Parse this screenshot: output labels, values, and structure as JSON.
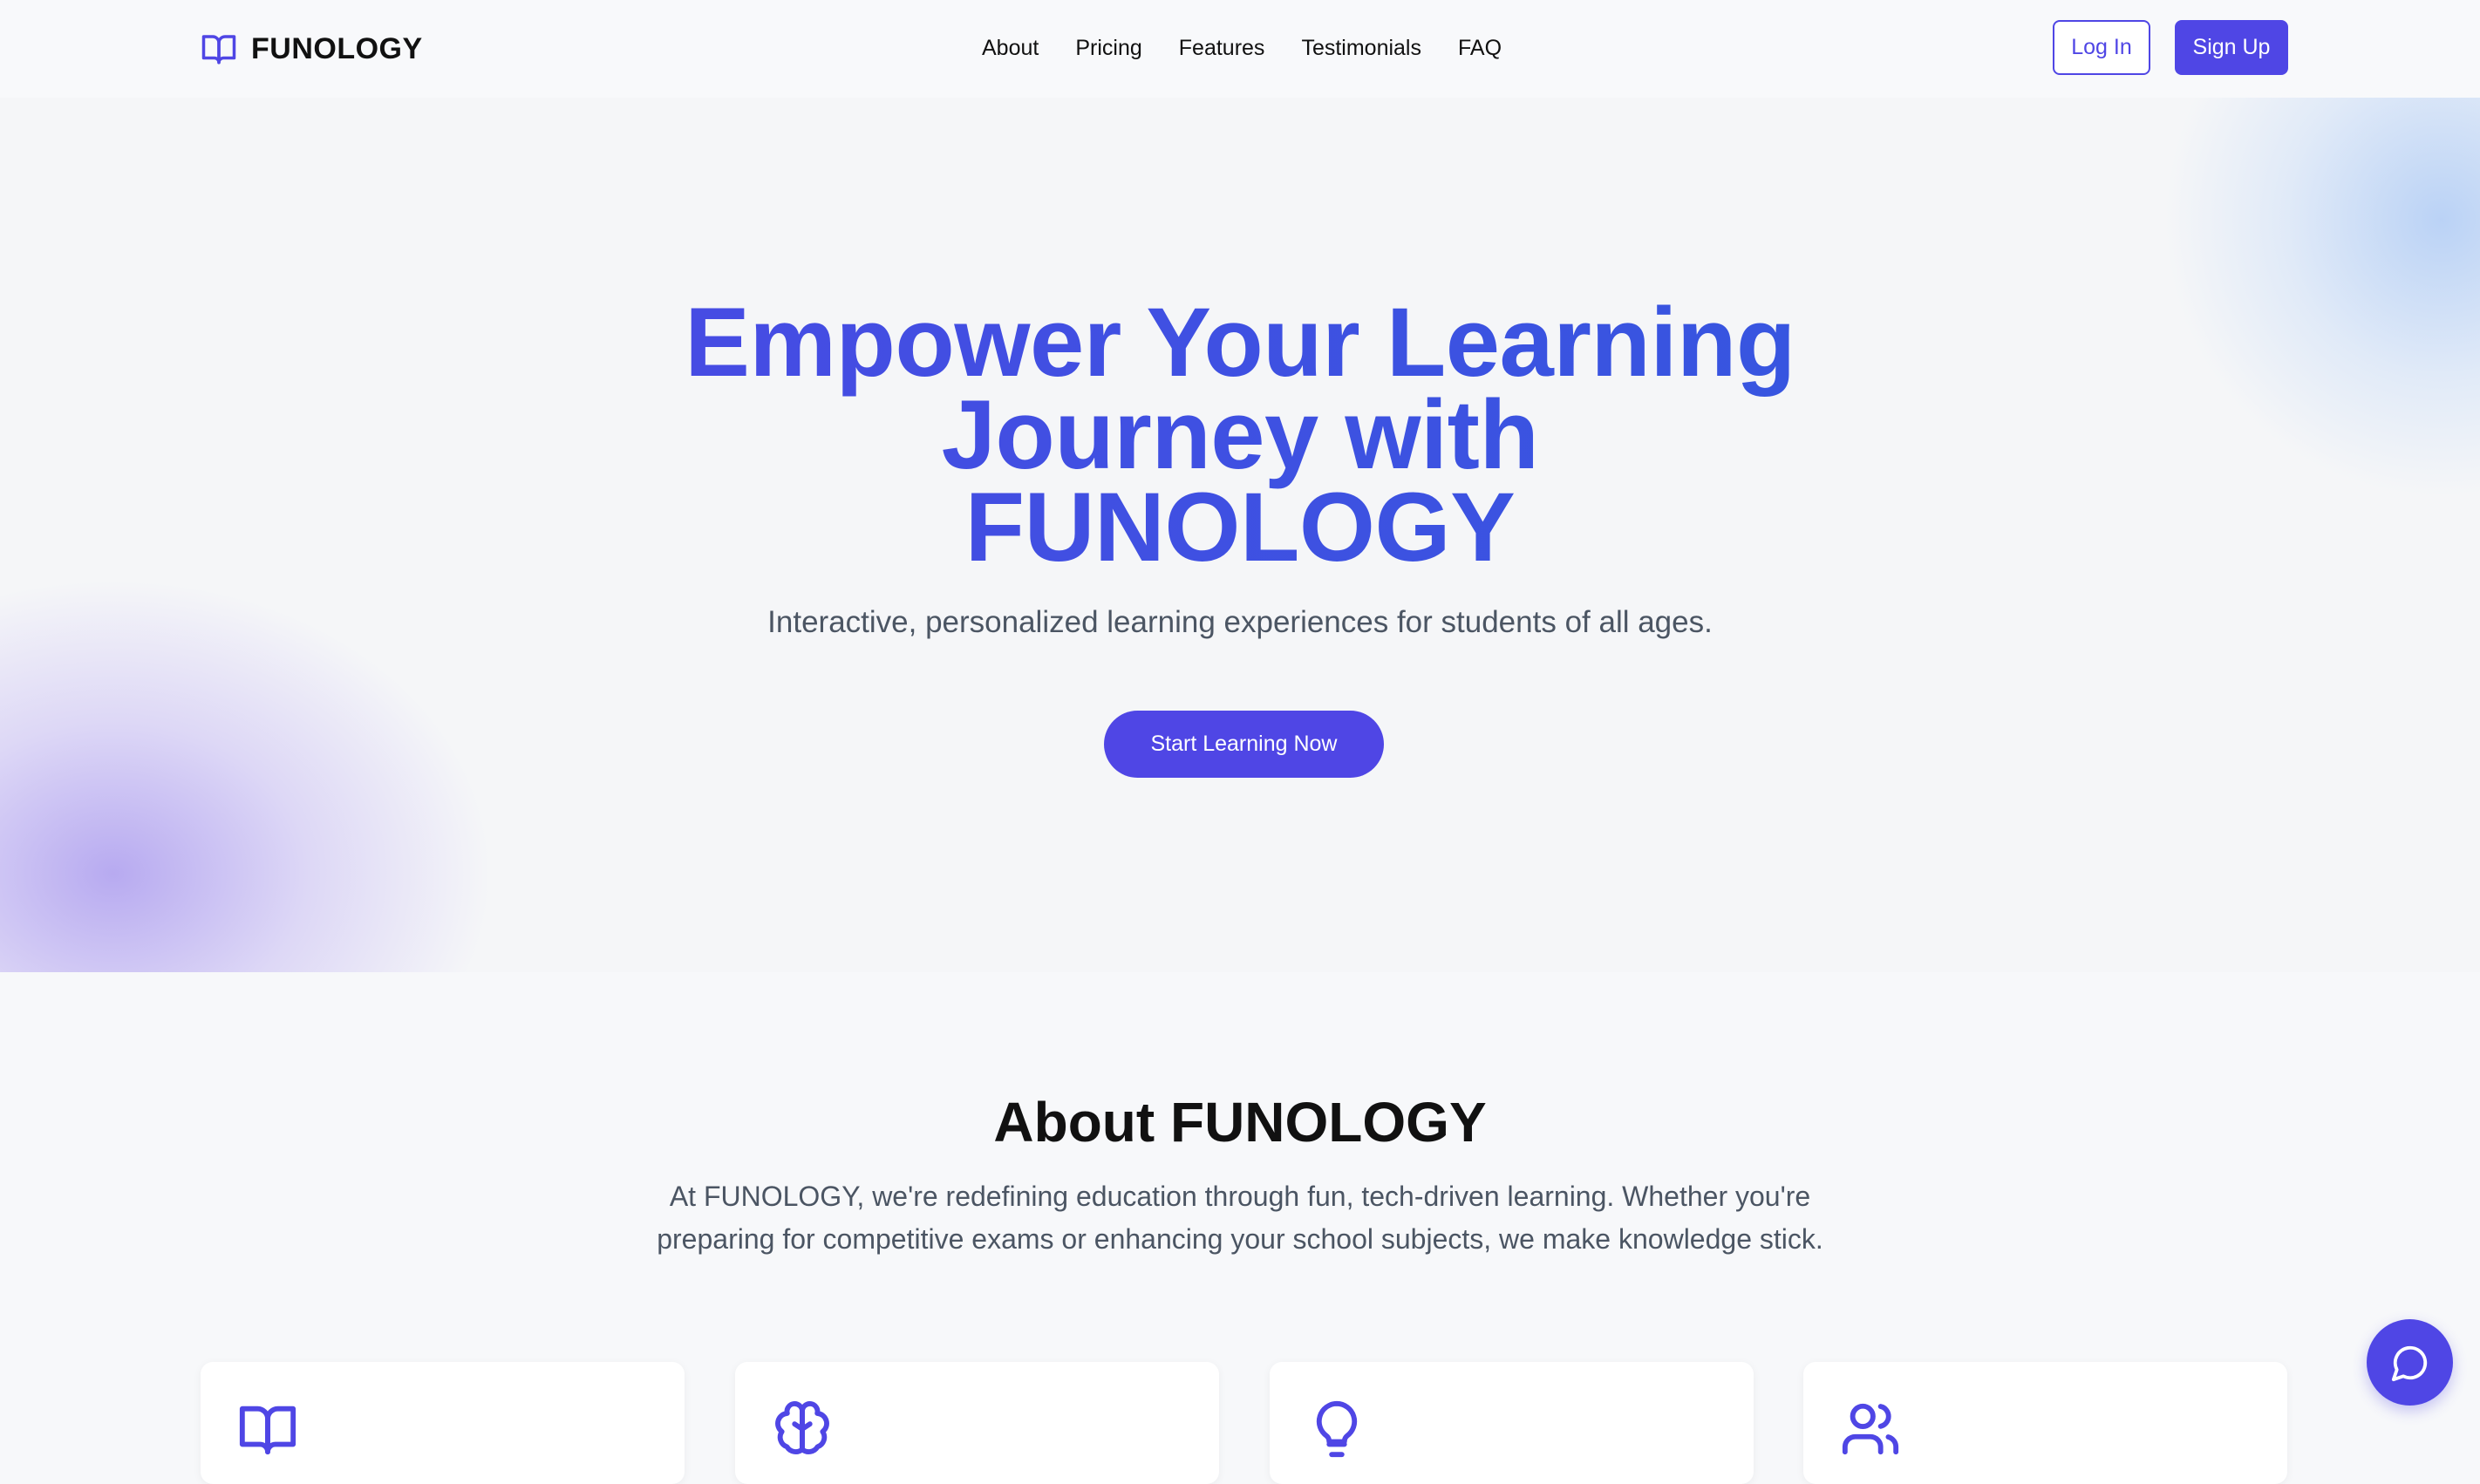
{
  "brand": {
    "name": "FUNOLOGY",
    "icon": "open-book-icon"
  },
  "nav": {
    "links": [
      "About",
      "Pricing",
      "Features",
      "Testimonials",
      "FAQ"
    ],
    "login_label": "Log In",
    "signup_label": "Sign Up"
  },
  "hero": {
    "title_line1": "Empower Your Learning",
    "title_line2": "Journey with",
    "title_line3": "FUNOLOGY",
    "subtitle": "Interactive, personalized learning experiences for students of all ages.",
    "cta_label": "Start Learning Now"
  },
  "about": {
    "title": "About FUNOLOGY",
    "text_line1": "At FUNOLOGY, we're redefining education through fun, tech-driven learning. Whether you're",
    "text_line2": "preparing for competitive exams or enhancing your school subjects, we make knowledge stick."
  },
  "feature_cards": [
    {
      "icon": "book-icon"
    },
    {
      "icon": "brain-icon"
    },
    {
      "icon": "lightbulb-icon"
    },
    {
      "icon": "users-icon"
    }
  ],
  "chat": {
    "icon": "chat-bubble-icon"
  },
  "colors": {
    "accent": "#4f46e5",
    "title_gradient_end": "#2e5bde",
    "muted_text": "#4b5563",
    "page_bg": "#f7f8fa"
  }
}
